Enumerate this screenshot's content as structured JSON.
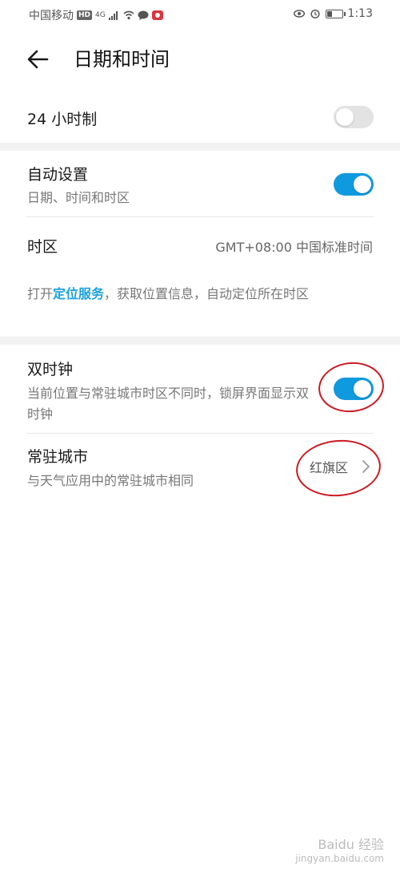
{
  "status_bar": {
    "carrier": "中国移动",
    "hd_badge": "HD",
    "network": "4G",
    "time": "1:13"
  },
  "header": {
    "title": "日期和时间"
  },
  "settings": {
    "hour24": {
      "label": "24 小时制",
      "enabled": false
    },
    "auto": {
      "label": "自动设置",
      "sublabel": "日期、时间和时区",
      "enabled": true
    },
    "timezone": {
      "label": "时区",
      "value": "GMT+08:00 中国标准时间"
    },
    "location_hint": {
      "prefix": "打开",
      "link": "定位服务",
      "suffix": "，获取位置信息，自动定位所在时区"
    },
    "dual_clock": {
      "label": "双时钟",
      "sublabel": "当前位置与常驻城市时区不同时，锁屏界面显示双时钟",
      "enabled": true
    },
    "home_city": {
      "label": "常驻城市",
      "sublabel": "与天气应用中的常驻城市相同",
      "value": "红旗区"
    }
  },
  "colors": {
    "toggle_on": "#0f9ae0",
    "toggle_off": "#e3e3e3",
    "link": "#1aa1df",
    "annotation": "#cc1b23",
    "section_gap": "#f2f2f2"
  },
  "watermark": {
    "line1": "Baidu 经验",
    "line2": "jingyan.baidu.com"
  }
}
